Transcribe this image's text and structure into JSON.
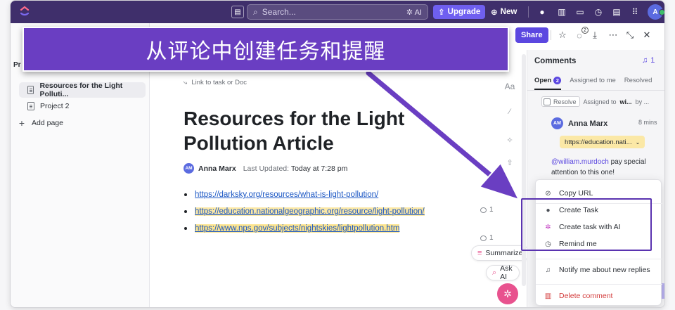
{
  "topbar": {
    "search_placeholder": "Search...",
    "ai_label": "AI",
    "upgrade_label": "Upgrade",
    "new_label": "New",
    "avatar_initial": "A"
  },
  "sidebar": {
    "cut_label": "Pr",
    "items": [
      {
        "label": "Resources for the Light Polluti...",
        "icon": "doc-icon",
        "active": true
      },
      {
        "label": "Project 2",
        "icon": "doc-icon",
        "active": false
      },
      {
        "label": "Add page",
        "icon": "plus-icon",
        "active": false
      }
    ]
  },
  "doc": {
    "link_to_task": "Link to task or Doc",
    "title": "Resources for the Light Pollution Article",
    "author": "Anna Marx",
    "author_initials": "AM",
    "last_updated_label": "Last Updated:",
    "last_updated_value": "Today at 7:28 pm",
    "links": [
      "https://darksky.org/resources/what-is-light-pollution/",
      "https://education.nationalgeographic.org/resource/light-pollution/",
      "https://www.nps.gov/subjects/nightskies/lightpollution.htm"
    ],
    "comment_counts": [
      "1",
      "1"
    ],
    "format_label": "Aa",
    "summarize_label": "Summarize",
    "ask_ai_label": "Ask AI"
  },
  "header": {
    "share_label": "Share",
    "notif_badge": "2"
  },
  "comments": {
    "title": "Comments",
    "bell_count": "1",
    "tabs": [
      {
        "label": "Open",
        "badge": "2",
        "active": true
      },
      {
        "label": "Assigned to me",
        "active": false
      },
      {
        "label": "Resolved",
        "active": false
      }
    ],
    "resolve_label": "Resolve",
    "assigned_text": "Assigned to",
    "assigned_user": "wi...",
    "assigned_by": "by ...",
    "author": "Anna Marx",
    "author_initials": "AM",
    "time": "8 mins",
    "url_chip": "https://education.nati...",
    "mention": "@william.murdoch",
    "text": " pay special attention to this one!"
  },
  "menu": {
    "items": [
      {
        "label": "Copy URL",
        "icon": "link-icon"
      },
      {
        "label": "Create Task",
        "icon": "check-circle-icon"
      },
      {
        "label": "Create task with AI",
        "icon": "ai-sparkle-icon"
      },
      {
        "label": "Remind me",
        "icon": "alarm-clock-icon"
      },
      {
        "label": "Notify me about new replies",
        "icon": "bell-icon"
      },
      {
        "label": "Delete comment",
        "icon": "trash-icon"
      }
    ]
  },
  "banner": {
    "text": "从评论中创建任务和提醒"
  },
  "colors": {
    "topbar": "#3f2f6b",
    "accent": "#5b47e0",
    "banner": "#6a3ec2",
    "highlight": "#fbe8a6",
    "annotation": "#5a33b0"
  }
}
